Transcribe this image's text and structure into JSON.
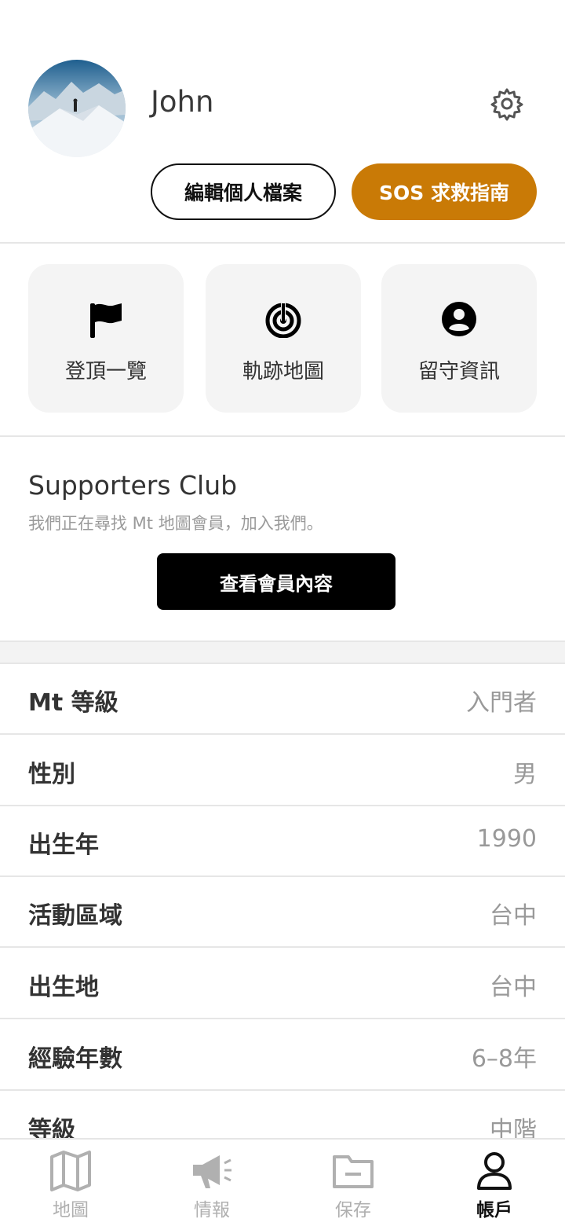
{
  "profile": {
    "name": "John",
    "edit_button": "編輯個人檔案",
    "sos_button": "SOS 求救指南",
    "accent_color": "#c97a06"
  },
  "tiles": [
    {
      "label": "登頂一覽",
      "icon": "flag-icon"
    },
    {
      "label": "軌跡地圖",
      "icon": "track-target-icon"
    },
    {
      "label": "留守資訊",
      "icon": "person-circle-icon"
    }
  ],
  "supporters": {
    "title": "Supporters Club",
    "subtitle": "我們正在尋找 Mt 地圖會員，加入我們。",
    "button": "查看會員內容"
  },
  "info_rows": [
    {
      "label": "Mt 等級",
      "value": "入門者"
    },
    {
      "label": "性別",
      "value": "男"
    },
    {
      "label": "出生年",
      "value": "1990"
    },
    {
      "label": "活動區域",
      "value": "台中"
    },
    {
      "label": "出生地",
      "value": "台中"
    },
    {
      "label": "經驗年數",
      "value": "6–8年"
    },
    {
      "label": "等級",
      "value": "中階"
    }
  ],
  "nav": [
    {
      "label": "地圖",
      "icon": "map-icon",
      "active": false
    },
    {
      "label": "情報",
      "icon": "megaphone-icon",
      "active": false
    },
    {
      "label": "保存",
      "icon": "folder-icon",
      "active": false
    },
    {
      "label": "帳戶",
      "icon": "account-icon",
      "active": true
    }
  ]
}
